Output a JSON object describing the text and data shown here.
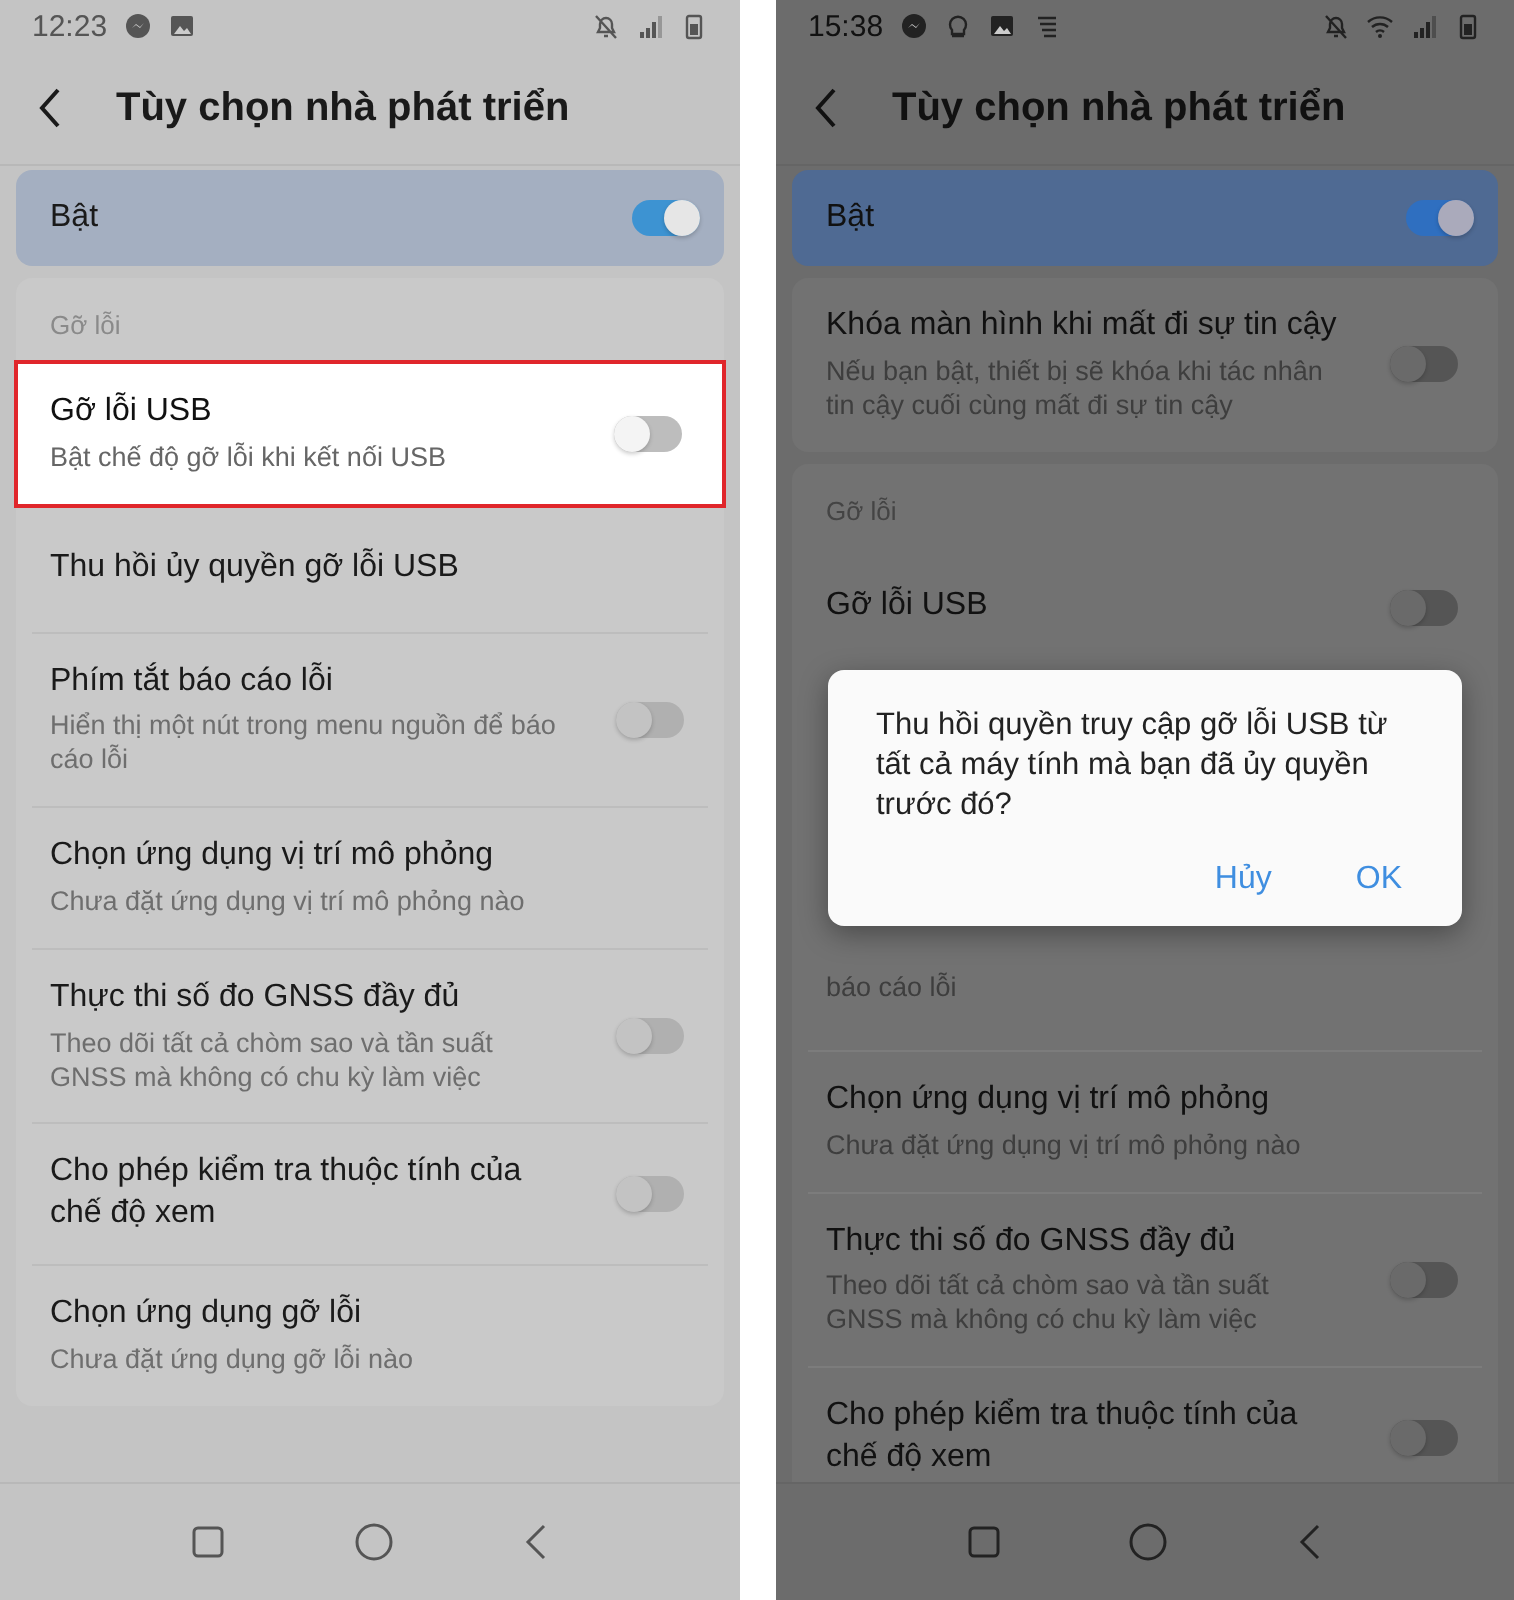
{
  "screens": [
    {
      "status_bar": {
        "time": "12:23",
        "icons": [
          {
            "kind": "messenger"
          },
          {
            "kind": "image"
          }
        ],
        "right_icons": [
          {
            "kind": "bell-off"
          },
          {
            "kind": "signal"
          },
          {
            "kind": "battery"
          }
        ]
      },
      "header": {
        "title": "Tùy chọn nhà phát triển"
      },
      "master": {
        "label": "Bật",
        "on": true
      },
      "cards": [
        {
          "label": "Gỡ lỗi",
          "items": [
            {
              "kind": "setting",
              "title": "Gỡ lỗi USB",
              "subtitle": "Bật chế độ gỡ lỗi khi kết nối USB",
              "on": false,
              "highlighted": true
            },
            {
              "kind": "setting",
              "title": "Thu hồi ủy quyền gỡ lỗi USB",
              "highlighted": false
            },
            {
              "kind": "setting",
              "title": "Phím tắt báo cáo lỗi",
              "subtitle": "Hiển thị một nút trong menu nguồn để báo cáo lỗi",
              "on": false,
              "highlighted": false
            },
            {
              "kind": "setting",
              "title": "Chọn ứng dụng vị trí mô phỏng",
              "subtitle": "Chưa đặt ứng dụng vị trí mô phỏng nào",
              "highlighted": false
            },
            {
              "kind": "setting",
              "title": "Thực thi số đo GNSS đầy đủ",
              "subtitle": "Theo dõi tất cả chòm sao và tần suất GNSS mà không có chu kỳ làm việc",
              "on": false,
              "highlighted": false
            },
            {
              "kind": "setting",
              "title": "Cho phép kiểm tra thuộc tính của chế độ xem",
              "on": false,
              "highlighted": false
            },
            {
              "kind": "setting",
              "title": "Chọn ứng dụng gỡ lỗi",
              "subtitle": "Chưa đặt ứng dụng gỡ lỗi nào",
              "highlighted": false
            }
          ]
        }
      ]
    },
    {
      "status_bar": {
        "time": "15:38",
        "icons": [
          {
            "kind": "messenger"
          },
          {
            "kind": "bulb"
          },
          {
            "kind": "image"
          },
          {
            "kind": "lines"
          }
        ],
        "right_icons": [
          {
            "kind": "bell-off"
          },
          {
            "kind": "wifi"
          },
          {
            "kind": "signal"
          },
          {
            "kind": "battery"
          }
        ]
      },
      "header": {
        "title": "Tùy chọn nhà phát triển"
      },
      "master": {
        "label": "Bật",
        "on": true
      },
      "cards": [
        {
          "items": [
            {
              "kind": "setting",
              "title": "Khóa màn hình khi mất đi sự tin cậy",
              "subtitle": "Nếu bạn bật, thiết bị sẽ khóa khi tác nhân tin cậy cuối cùng mất đi sự tin cậy",
              "on": false,
              "highlighted": false
            }
          ]
        },
        {
          "label": "Gỡ lỗi",
          "items": [
            {
              "kind": "setting",
              "title": "Gỡ lỗi USB",
              "on": false,
              "highlighted": false
            },
            {
              "kind": "dialog",
              "message": "Thu hồi quyền truy cập gỡ lỗi USB từ tất cả máy tính mà bạn đã ủy quyền trước đó?",
              "buttons": [
                "Hủy",
                "OK"
              ]
            },
            {
              "kind": "setting",
              "subtitle": "báo cáo lỗi",
              "highlighted": false
            },
            {
              "kind": "setting",
              "title": "Chọn ứng dụng vị trí mô phỏng",
              "subtitle": "Chưa đặt ứng dụng vị trí mô phỏng nào",
              "highlighted": false
            },
            {
              "kind": "setting",
              "title": "Thực thi số đo GNSS đầy đủ",
              "subtitle": "Theo dõi tất cả chòm sao và tần suất GNSS mà không có chu kỳ làm việc",
              "on": false,
              "highlighted": false
            },
            {
              "kind": "setting",
              "title": "Cho phép kiểm tra thuộc tính của chế độ xem",
              "on": false,
              "highlighted": false
            }
          ]
        }
      ]
    }
  ]
}
